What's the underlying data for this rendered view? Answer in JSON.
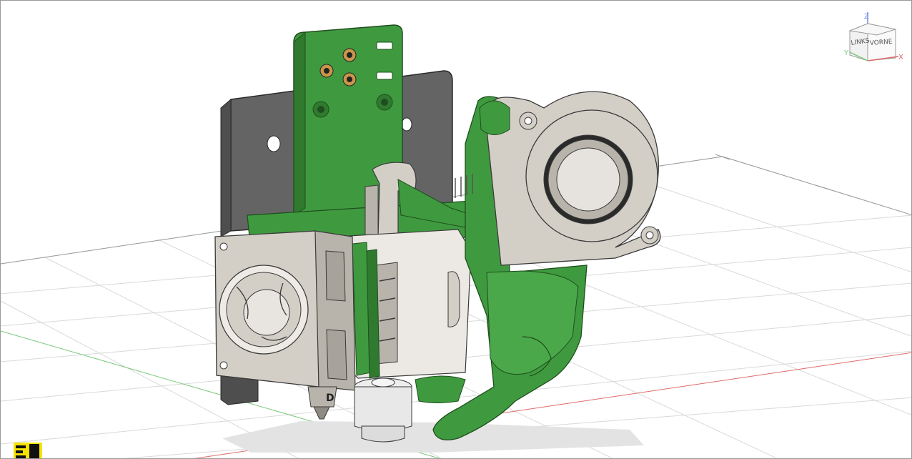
{
  "viewcube": {
    "face_left": "LINKS",
    "face_right": "VORNE",
    "axis_z": "Z",
    "axis_y": "Y",
    "axis_x": "X"
  },
  "part_labels": {
    "mount_letter": "D"
  },
  "colors": {
    "background": "#ffffff",
    "grid_line": "#d9d9d9",
    "grid_major": "#9b9b9b",
    "axis_red": "#e06a6a",
    "axis_green": "#79c779",
    "part_green": "#3f9a3f",
    "part_green_dark": "#2f7a2f",
    "part_gray": "#646464",
    "part_beige": "#d3cfc7",
    "part_beige_dark": "#b9b4ab",
    "metal": "#e8e8e8",
    "brass": "#c9964a",
    "marker_yellow": "#f5e400"
  },
  "icons": [
    "viewcube-icon",
    "fan-icon",
    "blower-fan-icon",
    "grid-icon"
  ]
}
